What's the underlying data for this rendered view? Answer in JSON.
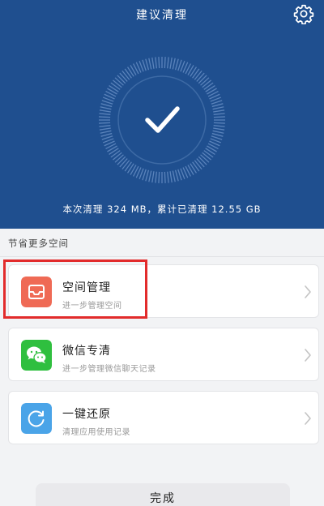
{
  "header": {
    "title": "建议清理",
    "settings_icon": "gear-icon",
    "status_icon": "checkmark-icon",
    "summary": "本次清理 324 MB，累计已清理 12.55 GB",
    "background_color": "#1f4f8f"
  },
  "section": {
    "label": "节省更多空间"
  },
  "items": [
    {
      "title": "空间管理",
      "subtitle": "进一步管理空间",
      "icon": "storage-box-icon",
      "icon_color": "#ef6a55"
    },
    {
      "title": "微信专清",
      "subtitle": "进一步管理微信聊天记录",
      "icon": "wechat-icon",
      "icon_color": "#2fbf3f"
    },
    {
      "title": "一键还原",
      "subtitle": "清理应用使用记录",
      "icon": "restore-icon",
      "icon_color": "#4aa4e8"
    }
  ],
  "footer": {
    "done_label": "完成"
  }
}
